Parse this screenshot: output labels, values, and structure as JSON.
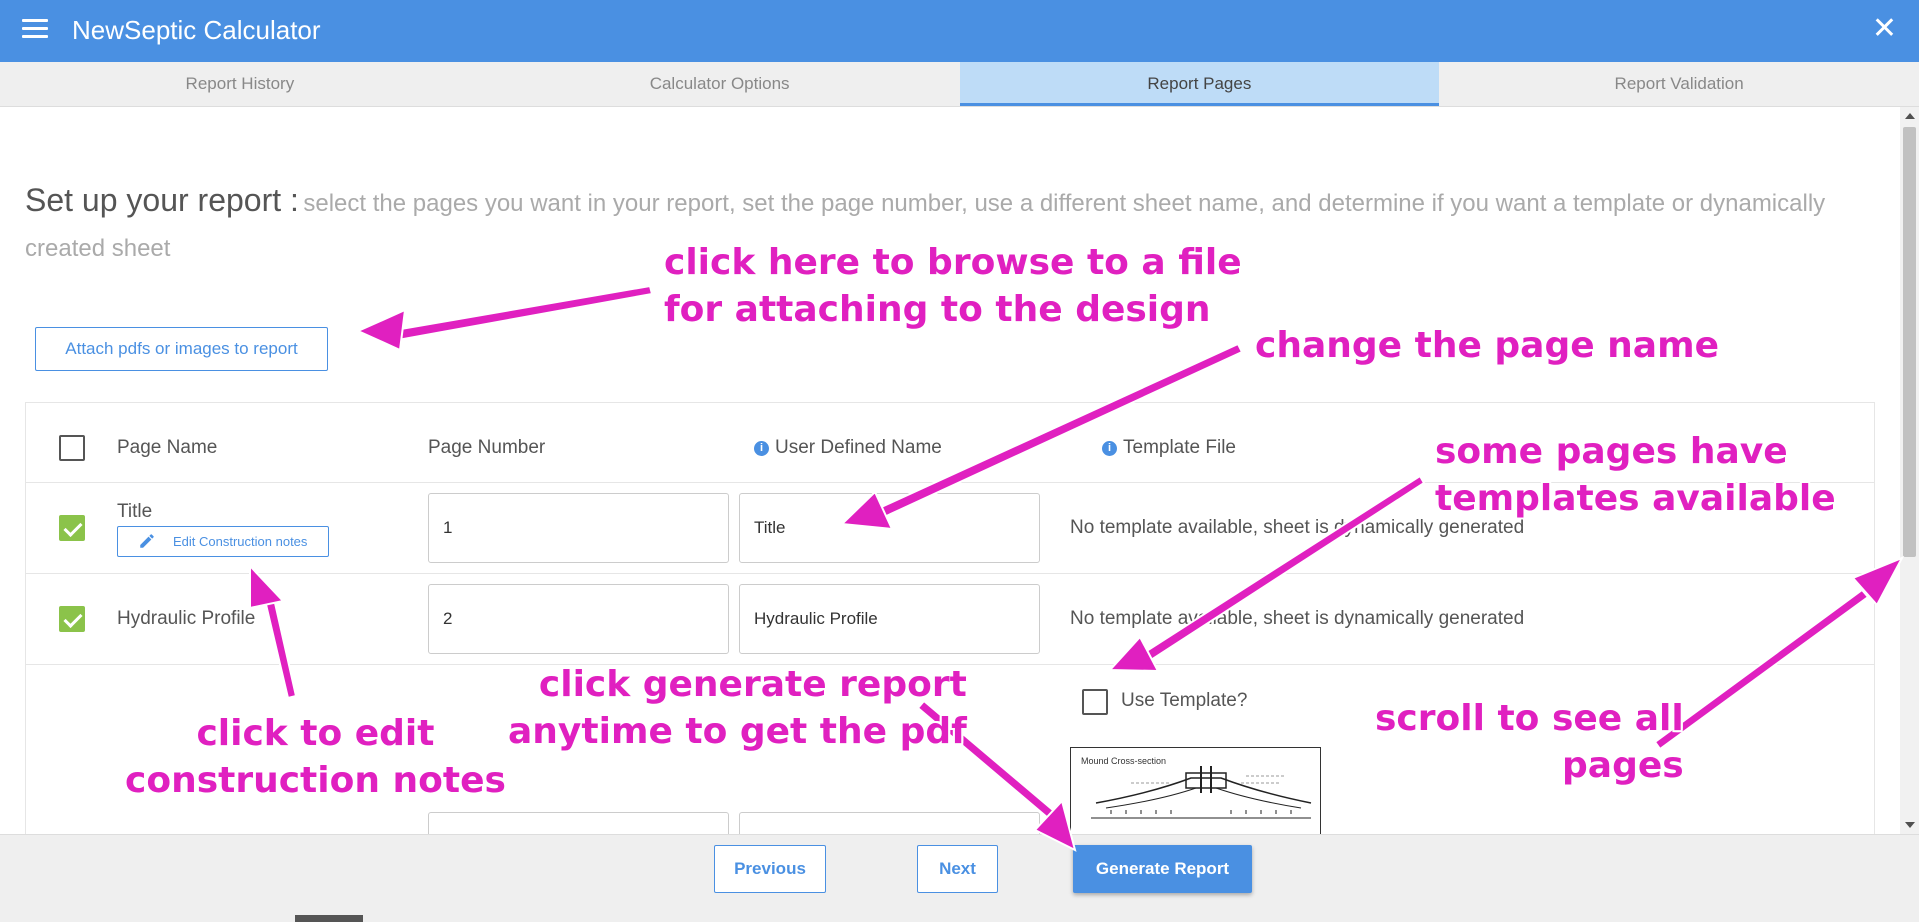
{
  "app": {
    "title": "NewSeptic Calculator",
    "close_symbol": "✕"
  },
  "tabs": [
    {
      "label": "Report History",
      "active": false
    },
    {
      "label": "Calculator Options",
      "active": false
    },
    {
      "label": "Report Pages",
      "active": true
    },
    {
      "label": "Report Validation",
      "active": false
    }
  ],
  "main": {
    "heading": "Set up your report :",
    "subheading": "select the pages you want in your report, set the page number, use a different sheet name, and determine if you want a template or dynamically created sheet",
    "attach_label": "Attach pdfs or images to report"
  },
  "table": {
    "headers": {
      "page_name": "Page Name",
      "page_number": "Page Number",
      "user_defined_name": "User Defined Name",
      "template_file": "Template File"
    },
    "info_symbol": "i",
    "rows": [
      {
        "checked": true,
        "page_name": "Title",
        "edit_label": "Edit Construction notes",
        "page_number": "1",
        "user_defined_name": "Title",
        "template": "No template available, sheet is dynamically generated"
      },
      {
        "checked": true,
        "page_name": "Hydraulic Profile",
        "page_number": "2",
        "user_defined_name": "Hydraulic Profile",
        "template": "No template available, sheet is dynamically generated"
      },
      {
        "checked": false,
        "use_template_label": "Use Template?",
        "thumbnail_title": "Mound Cross-section"
      }
    ]
  },
  "footer": {
    "previous_label": "Previous",
    "next_label": "Next",
    "generate_label": "Generate Report"
  },
  "annotations": {
    "browse": [
      "click here to browse to a file",
      "for attaching to the design"
    ],
    "change_name": "change the page name",
    "templates": [
      "some pages have",
      "templates available"
    ],
    "edit_notes": [
      "click to edit",
      "construction notes"
    ],
    "generate": [
      "click generate report",
      "anytime to get the pdf"
    ],
    "scroll": [
      "scroll to see all",
      "pages"
    ],
    "color": "#e020c0"
  },
  "colors": {
    "primary": "#4a90e2",
    "checkbox_checked": "#8bc34a",
    "active_tab": "#bedcf7"
  }
}
